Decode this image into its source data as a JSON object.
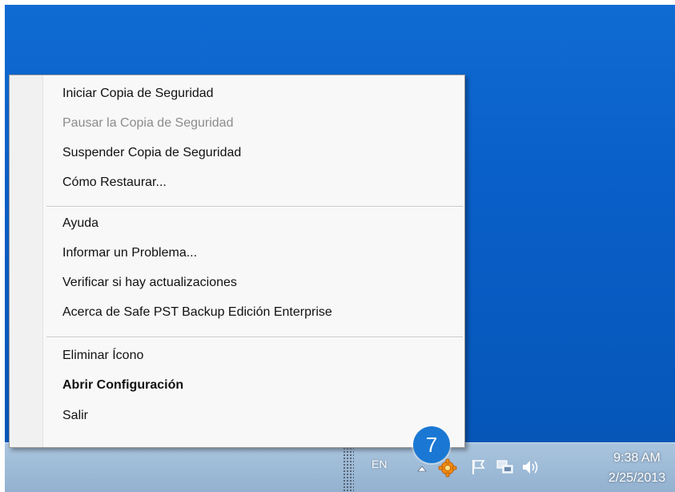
{
  "context_menu": {
    "items": [
      {
        "label": "Iniciar Copia de Seguridad",
        "enabled": true,
        "bold": false
      },
      {
        "label": "Pausar la Copia de Seguridad",
        "enabled": false,
        "bold": false
      },
      {
        "label": "Suspender Copia de Seguridad",
        "enabled": true,
        "bold": false
      },
      {
        "label": "Cómo Restaurar...",
        "enabled": true,
        "bold": false
      },
      {
        "label": "Ayuda",
        "enabled": true,
        "bold": false
      },
      {
        "label": "Informar un Problema...",
        "enabled": true,
        "bold": false
      },
      {
        "label": "Verificar si hay actualizaciones",
        "enabled": true,
        "bold": false
      },
      {
        "label": "Acerca de Safe PST Backup Edición Enterprise",
        "enabled": true,
        "bold": false
      },
      {
        "label": "Eliminar Ícono",
        "enabled": true,
        "bold": false
      },
      {
        "label": "Abrir Configuración",
        "enabled": true,
        "bold": true
      },
      {
        "label": "Salir",
        "enabled": true,
        "bold": false
      }
    ]
  },
  "step_badge": {
    "number": "7",
    "color": "#1a78d4"
  },
  "taskbar": {
    "language": "EN",
    "tray_icons": [
      "show-hidden-icons-arrow-icon",
      "safe-pst-backup-icon",
      "action-center-flag-icon",
      "network-icon",
      "volume-icon"
    ],
    "clock": {
      "time": "9:38 AM",
      "date": "2/25/2013"
    }
  },
  "colors": {
    "desktop": "#0a5fc8",
    "taskbar": "#9fbcd8",
    "menu_background": "#f8f8f8",
    "disabled_text": "#8c8c8c"
  }
}
